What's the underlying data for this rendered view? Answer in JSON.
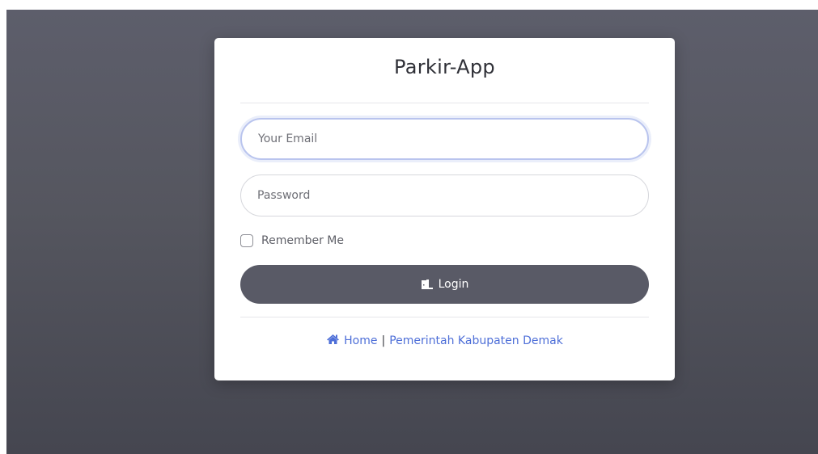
{
  "app": {
    "title": "Parkir-App"
  },
  "form": {
    "email_placeholder": "Your Email",
    "password_placeholder": "Password",
    "remember_label": "Remember Me",
    "login_label": "Login"
  },
  "footer": {
    "home_label": "Home",
    "separator": "|",
    "org_label": "Pemerintah Kabupaten Demak"
  },
  "icons": {
    "login": "door-open-icon",
    "home": "home-icon"
  },
  "colors": {
    "background": "#55565f",
    "button": "#595a66",
    "link": "#4e6fd8",
    "focus_border": "#b9c4ee"
  }
}
